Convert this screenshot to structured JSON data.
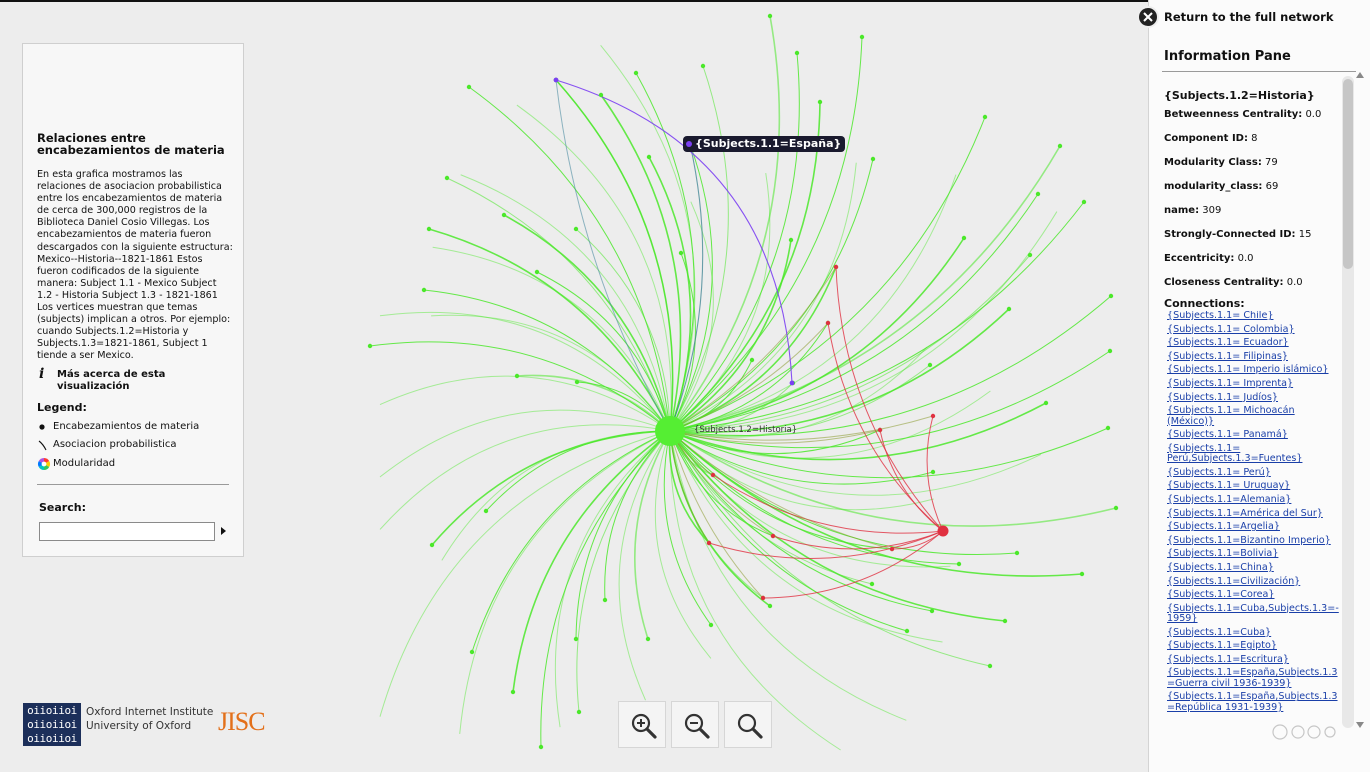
{
  "left_panel": {
    "title": "Relaciones entre encabezamientos de materia",
    "description": "En esta grafica mostramos las relaciones de asociacion probabilistica entre los encabezamientos de materia de cerca de 300,000 registros de la Biblioteca Daniel Cosio Villegas. Los encabezamientos de materia fueron descargados con la siguiente estructura: Mexico--Historia--1821-1861 Estos fueron codificados de la siguiente manera: Subject 1.1 - Mexico Subject 1.2 - Historia Subject 1.3 - 1821-1861 Los vertices muestran que temas (subjects) implican a otros. Por ejemplo: cuando Subjects.1.2=Historia y Subjects.1.3=1821-1861, Subject 1 tiende a ser Mexico.",
    "more_link": "Más acerca de esta visualización",
    "legend_title": "Legend:",
    "legend": [
      {
        "label": "Encabezamientos de materia",
        "icon": "dot-icon"
      },
      {
        "label": "Asociacion probabilistica",
        "icon": "edge-icon"
      },
      {
        "label": "Modularidad",
        "icon": "color-wheel-icon"
      }
    ],
    "search_title": "Search:",
    "search_value": ""
  },
  "logos": {
    "oii_mark": [
      "oiioiioi",
      "oiioiioi",
      "oiioiioi"
    ],
    "oii_line1": "Oxford Internet Institute",
    "oii_line2": "University of Oxford",
    "jisc": "JISC"
  },
  "network": {
    "hover_label": "{Subjects.1.1=España}",
    "center_label": "{Subjects.1.2=Historia}",
    "colors": {
      "main_edges": "#4be82a",
      "secondary_edges": "#e03040",
      "highlight_edge": "#7b3ff2",
      "hub": "#55ee33"
    }
  },
  "zoom": {
    "icons": [
      "zoom-in-icon",
      "zoom-out-icon",
      "zoom-reset-icon"
    ]
  },
  "right_pane": {
    "return_label": "Return to the full network",
    "pane_title": "Information Pane",
    "node_title": "{Subjects.1.2=Historia}",
    "attributes": [
      {
        "key": "Betweenness Centrality:",
        "value": "0.0"
      },
      {
        "key": "Component ID:",
        "value": "8"
      },
      {
        "key": "Modularity Class:",
        "value": "79"
      },
      {
        "key": "modularity_class:",
        "value": "69"
      },
      {
        "key": "name:",
        "value": "309"
      },
      {
        "key": "Strongly-Connected ID:",
        "value": "15"
      },
      {
        "key": "Eccentricity:",
        "value": "0.0"
      },
      {
        "key": "Closeness Centrality:",
        "value": "0.0"
      }
    ],
    "connections_title": "Connections:",
    "connections": [
      "{Subjects.1.1= Chile}",
      "{Subjects.1.1= Colombia}",
      "{Subjects.1.1= Ecuador}",
      "{Subjects.1.1= Filipinas}",
      "{Subjects.1.1= Imperio islámico}",
      "{Subjects.1.1= Imprenta}",
      "{Subjects.1.1= Judíos}",
      "{Subjects.1.1= Michoacán (México)}",
      "{Subjects.1.1= Panamá}",
      "{Subjects.1.1= Perú,Subjects.1.3=Fuentes}",
      "{Subjects.1.1= Perú}",
      "{Subjects.1.1= Uruguay}",
      "{Subjects.1.1=Alemania}",
      "{Subjects.1.1=América del Sur}",
      "{Subjects.1.1=Argelia}",
      "{Subjects.1.1=Bizantino Imperio}",
      "{Subjects.1.1=Bolivia}",
      "{Subjects.1.1=China}",
      "{Subjects.1.1=Civilización}",
      "{Subjects.1.1=Corea}",
      "{Subjects.1.1=Cuba,Subjects.1.3=-1959}",
      "{Subjects.1.1=Cuba}",
      "{Subjects.1.1=Egipto}",
      "{Subjects.1.1=Escritura}",
      "{Subjects.1.1=España,Subjects.1.3=Guerra civil 1936-1939}",
      "{Subjects.1.1=España,Subjects.1.3=República 1931-1939}"
    ]
  }
}
